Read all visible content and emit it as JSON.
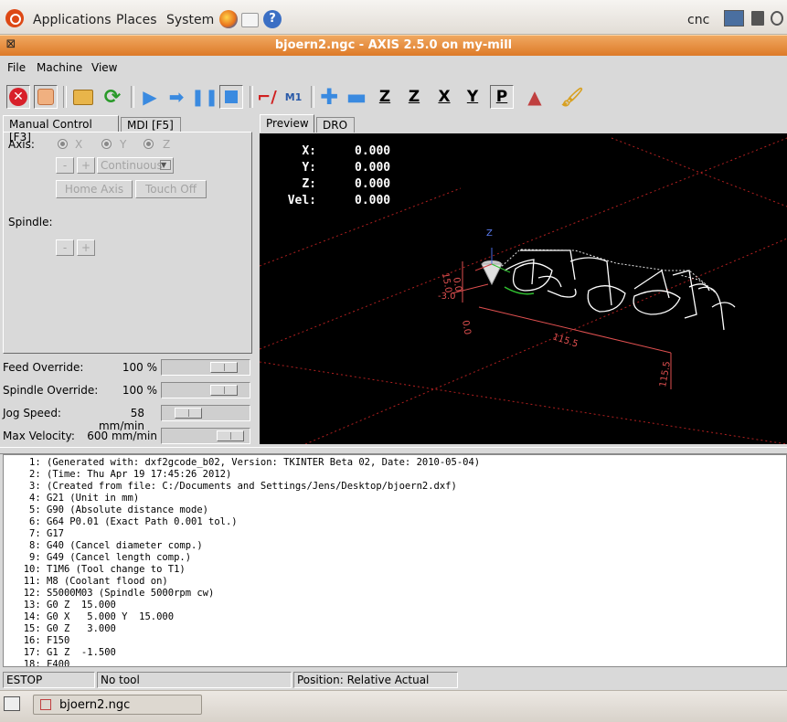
{
  "top_panel": {
    "menus": [
      "Applications",
      "Places",
      "System"
    ],
    "username": "cnc"
  },
  "window": {
    "title": "bjoern2.ngc - AXIS 2.5.0 on my-mill"
  },
  "menubar": [
    "File",
    "Machine",
    "View"
  ],
  "toolbar": {
    "buttons": [
      "estop",
      "power",
      "open",
      "reload",
      "run",
      "step",
      "pause",
      "stop",
      "touch-off-toggle",
      "m1",
      "zoom-in",
      "zoom-out",
      "view-z",
      "view-z-rotated",
      "view-x",
      "view-y",
      "view-p",
      "toggle-plot",
      "clear-plot"
    ],
    "labels": {
      "m1": "M1",
      "z": "Z",
      "z2": "Z",
      "x": "X",
      "y": "Y",
      "p": "P"
    }
  },
  "left_tabs": [
    "Manual Control [F3]",
    "MDI [F5]"
  ],
  "manual": {
    "axis_label": "Axis:",
    "axes": [
      "X",
      "Y",
      "Z"
    ],
    "minus": "-",
    "plus": "+",
    "jog_mode": "Continuous",
    "home_button": "Home Axis",
    "touchoff_button": "Touch Off",
    "spindle_label": "Spindle:"
  },
  "overrides": [
    {
      "label": "Feed Override:",
      "value": "100 %",
      "fraction": 0.83
    },
    {
      "label": "Spindle Override:",
      "value": "100 %",
      "fraction": 0.83
    },
    {
      "label": "Jog Speed:",
      "value": "58 mm/min",
      "fraction": 0.2
    },
    {
      "label": "Max Velocity:",
      "value": "600 mm/min",
      "fraction": 0.93
    }
  ],
  "right_tabs": [
    "Preview",
    "DRO"
  ],
  "dro": [
    {
      "axis": "X:",
      "value": "0.000"
    },
    {
      "axis": "Y:",
      "value": "0.000"
    },
    {
      "axis": "Z:",
      "value": "0.000"
    },
    {
      "axis": "Vel:",
      "value": "0.000"
    }
  ],
  "preview_labels": {
    "z_axis": "Z",
    "dim_15": "15.0",
    "dim_0": "0.0",
    "dim_neg3": "-3.0",
    "dim_0b": "0.0",
    "dim_115": "115.5",
    "dim_115b": "115.5"
  },
  "gcode": [
    "(Generated with: dxf2gcode_b02, Version: TKINTER Beta 02, Date: 2010-05-04)",
    "(Time: Thu Apr 19 17:45:26 2012)",
    "(Created from file: C:/Documents and Settings/Jens/Desktop/bjoern2.dxf)",
    "G21 (Unit in mm)",
    "G90 (Absolute distance mode)",
    "G64 P0.01 (Exact Path 0.001 tol.)",
    "G17",
    "G40 (Cancel diameter comp.)",
    "G49 (Cancel length comp.)",
    "T1M6 (Tool change to T1)",
    "M8 (Coolant flood on)",
    "S5000M03 (Spindle 5000rpm cw)",
    "G0 Z  15.000",
    "G0 X   5.000 Y  15.000",
    "G0 Z   3.000",
    "F150",
    "G1 Z  -1.500",
    "F400"
  ],
  "status": {
    "estop": "ESTOP",
    "tool": "No tool",
    "position": "Position: Relative Actual"
  },
  "taskbar": {
    "item": "bjoern2.ngc"
  },
  "colors": {
    "titlebar": "#dd7a28",
    "preview_bg": "#000000",
    "grid": "#b02020",
    "path": "#ffffff",
    "dim": "#e05050"
  }
}
